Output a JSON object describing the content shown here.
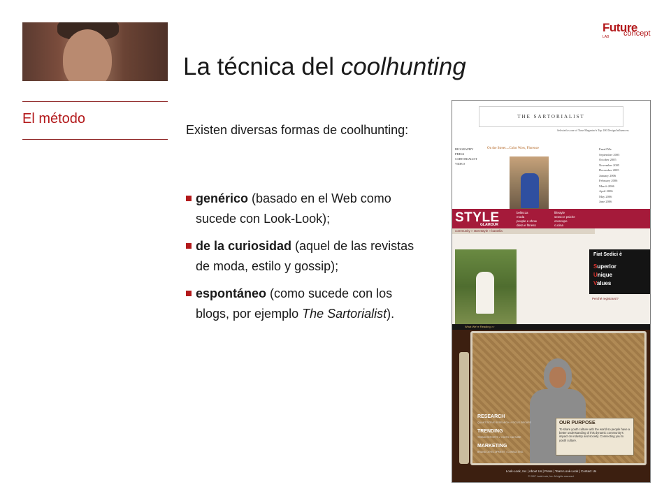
{
  "logo": {
    "line1": "Future",
    "line2": "concept",
    "line3": "LAB"
  },
  "title": {
    "text": "La técnica del ",
    "emphasis": "coolhunting"
  },
  "section": {
    "label": "El método"
  },
  "intro": "Existen diversas formas de coolhunting:",
  "bullets": [
    {
      "bold": "genérico",
      "before": " (basado en el Web como sucede con Look-Look);",
      "italic": "",
      "after": ""
    },
    {
      "bold": "de la curiosidad",
      "before": " (aquel de las revistas de moda, estilo y gossip);",
      "italic": "",
      "after": ""
    },
    {
      "bold": "espontáneo",
      "before": " (como sucede con los blogs, por ejemplo ",
      "italic": "The Sartorialist",
      "after": ")."
    }
  ],
  "collage": {
    "sartorialist": {
      "masthead": "THE SARTORIALIST",
      "tagline": "Selected as one of Time Magazine's Top 100 Design Influencers",
      "nav": [
        "BIOGRAPHY",
        "PRESS",
        "SARTORIALIST",
        "VIDEO"
      ],
      "post_title": "On the Street....Color Wow, Florence",
      "archive": [
        "Email Me",
        "September 2005",
        "October 2005",
        "November 2005",
        "December 2005",
        "January 2006",
        "February 2006",
        "March 2006",
        "April 2006",
        "May 2006",
        "June 2006"
      ]
    },
    "style": {
      "logo": "STYLE",
      "sub": "GLAMOUR",
      "menu1": [
        "bellezza",
        "moda",
        "people e show",
        "dieta e fitness"
      ],
      "menu2": [
        "lifestyle",
        "sesso e psiche",
        "oroscopo",
        "cucina"
      ],
      "crumb": "community » streetstyle » bastella",
      "ad_heading": "Fiat Sedici è",
      "ad_words": [
        {
          "initial": "S",
          "rest": "uperior"
        },
        {
          "initial": "U",
          "rest": "nique"
        },
        {
          "initial": "V",
          "rest": "alues"
        }
      ],
      "perche": "Perché registrarsi?"
    },
    "looklook": {
      "top": "What We're Reading >>",
      "links": [
        {
          "label": "RESEARCH",
          "sub": "QUANTITATIVE RESEARCH • FOCUS GROUPS"
        },
        {
          "label": "TRENDING",
          "sub": "TREND REPORTS • YOUTH CULTURE"
        },
        {
          "label": "MARKETING",
          "sub": "BRAND DEVELOPMENT • CONSULTING"
        }
      ],
      "purpose_heading": "OUR PURPOSE",
      "purpose_text": "To share youth culture with the world so people have a better understanding of this dynamic community's impact on industry and society. Connecting you to youth culture.",
      "footer": "Look-Look, Inc | About Us | Press | Team Look-Look | Contact Us",
      "copyright": "© 2007 Look-Look, Inc. All rights reserved."
    }
  }
}
